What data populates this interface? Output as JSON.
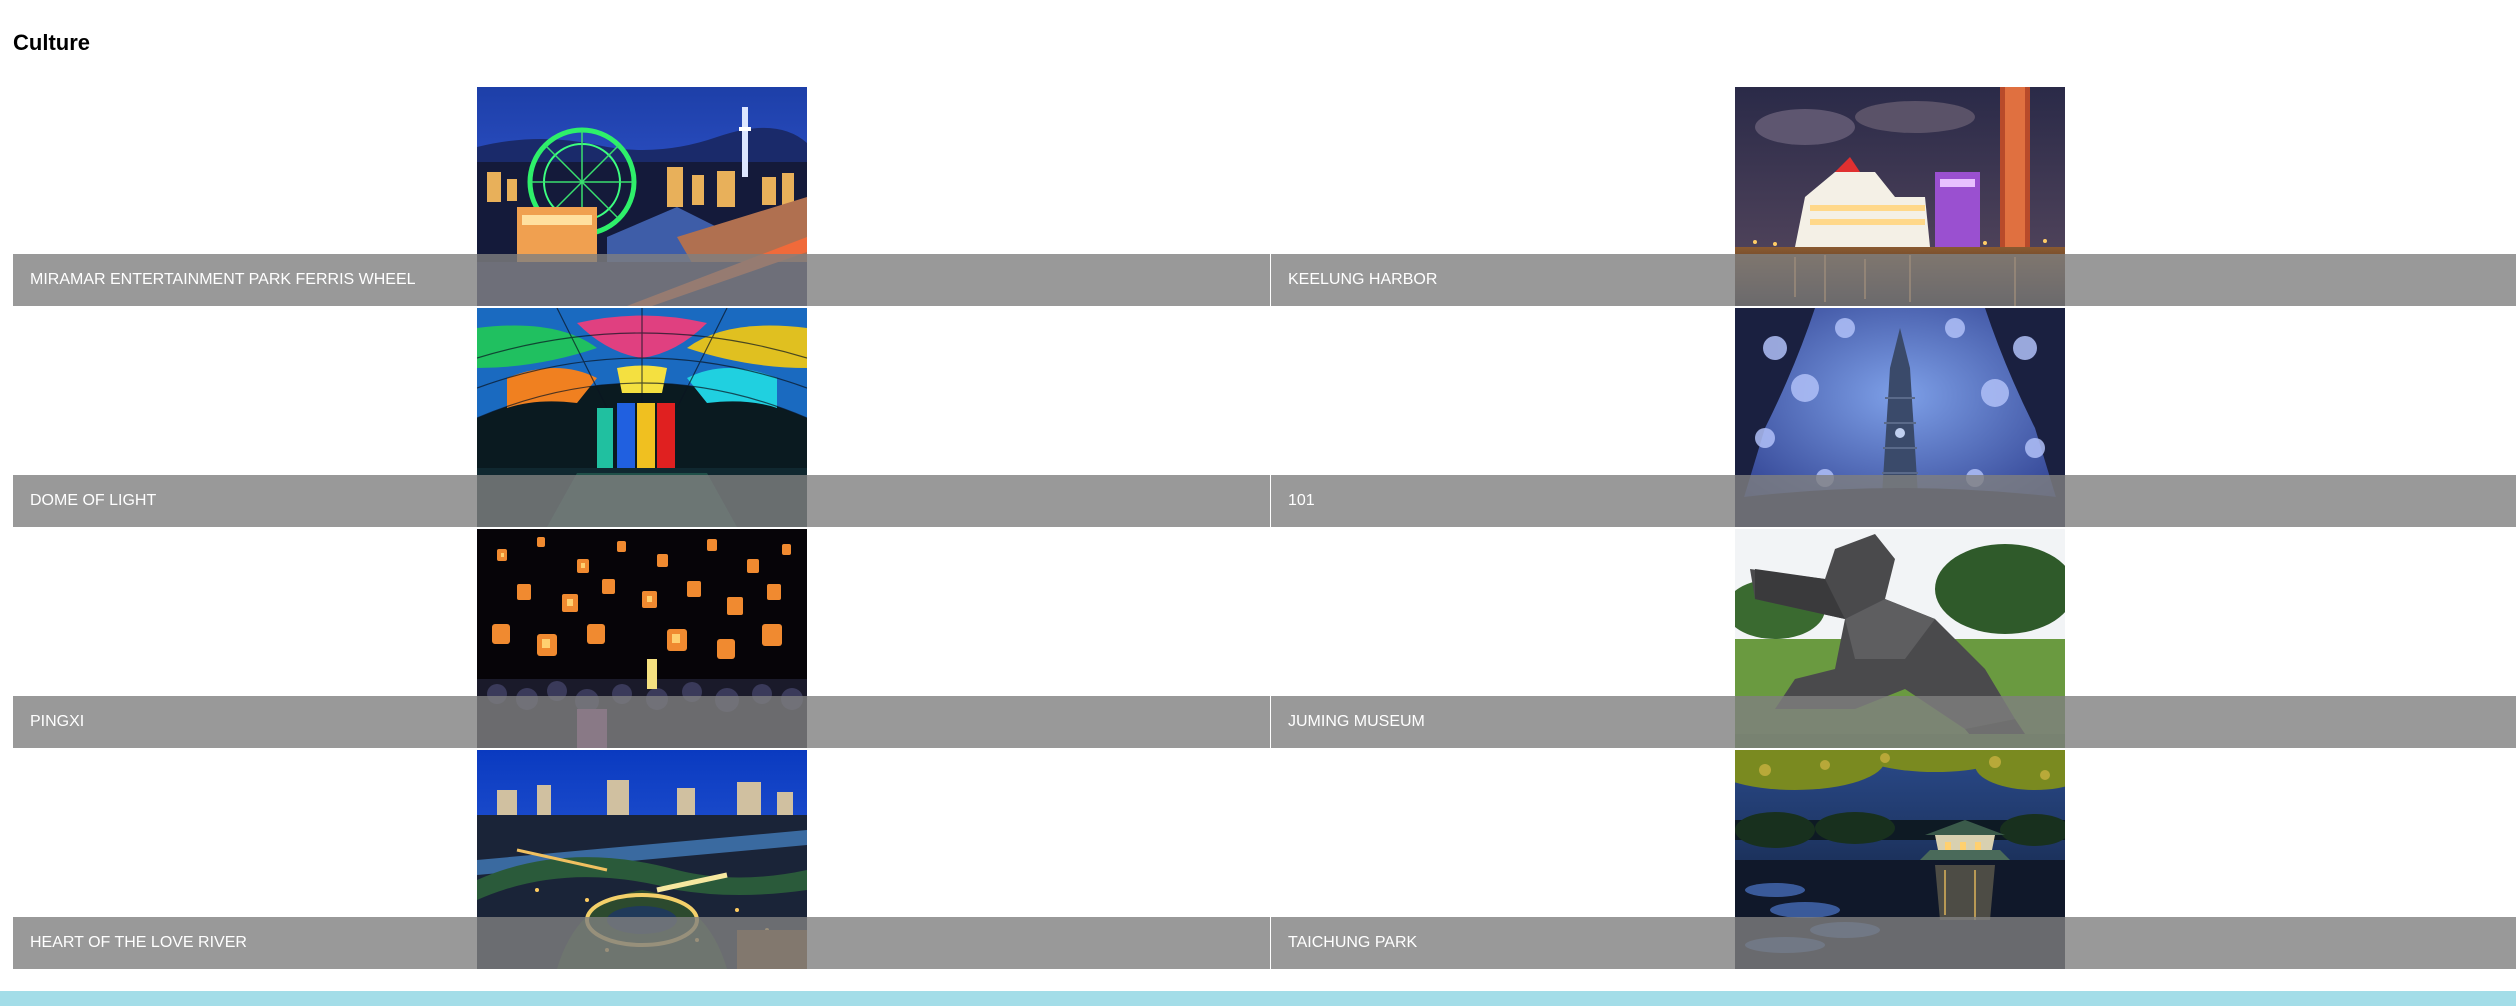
{
  "page": {
    "title": "Culture"
  },
  "tiles": [
    {
      "id": "miramar",
      "label": "MIRAMAR ENTERTAINMENT PARK FERRIS WHEEL",
      "photo": "city-skyline-ferris-wheel-night"
    },
    {
      "id": "keelung",
      "label": "KEELUNG HARBOR",
      "photo": "harbor-ship-night"
    },
    {
      "id": "dome",
      "label": "DOME OF LIGHT",
      "photo": "stained-glass-dome"
    },
    {
      "id": "taipei101",
      "label": "101",
      "photo": "tower-through-trees"
    },
    {
      "id": "pingxi",
      "label": "PINGXI",
      "photo": "sky-lanterns"
    },
    {
      "id": "juming",
      "label": "JUMING MUSEUM",
      "photo": "taichi-sculpture"
    },
    {
      "id": "loveriver",
      "label": "HEART OF THE LOVE RIVER",
      "photo": "river-park-night"
    },
    {
      "id": "taichung",
      "label": "TAICHUNG PARK",
      "photo": "lake-pavilion-night"
    }
  ],
  "colors": {
    "caption_background": "#8c8c8c",
    "caption_text": "#ffffff",
    "footer_bar": "#a3dde8",
    "page_background": "#ffffff"
  }
}
